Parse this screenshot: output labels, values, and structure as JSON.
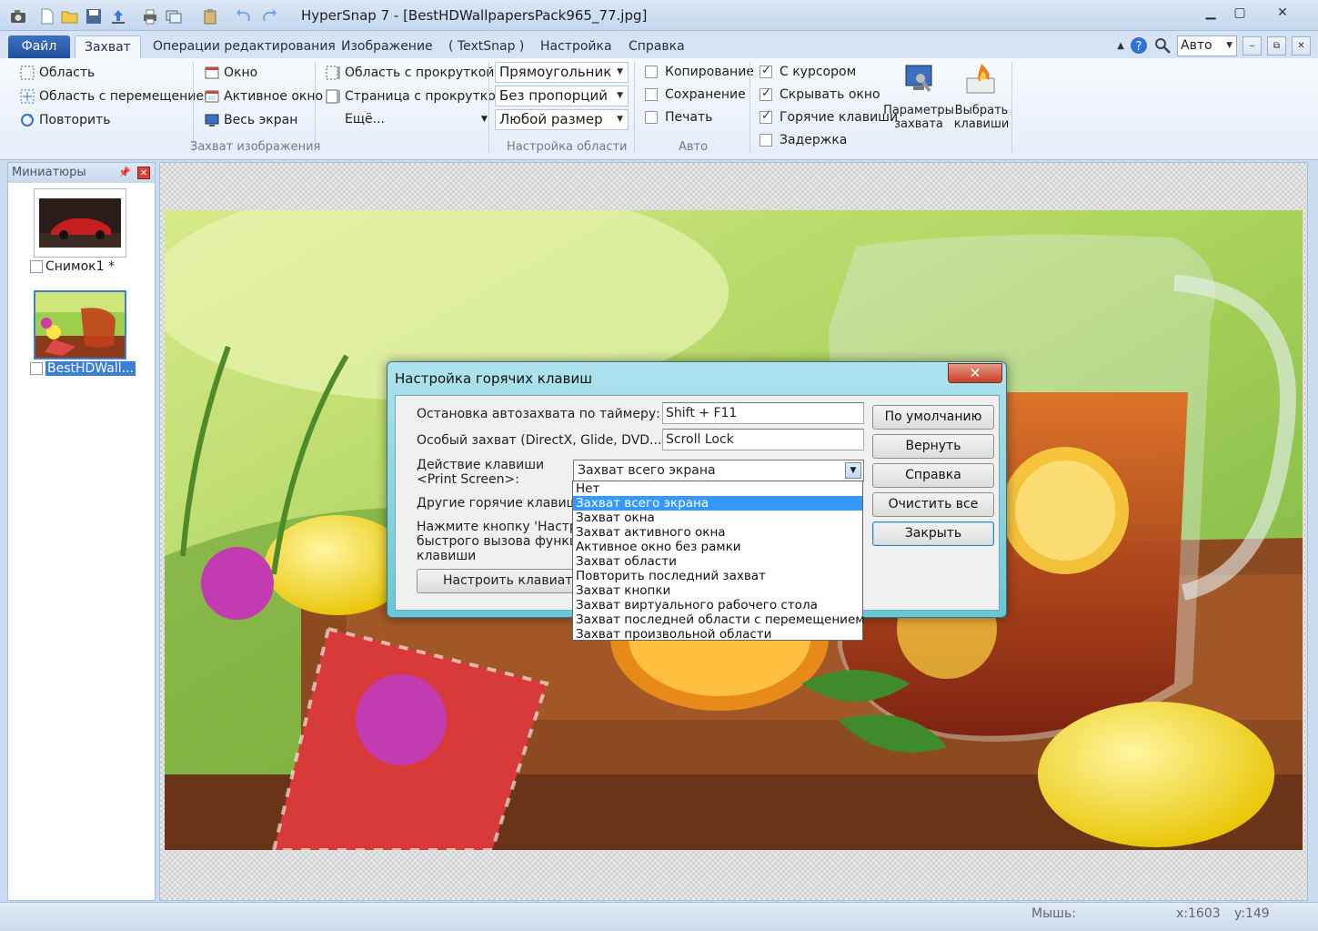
{
  "window": {
    "title": "HyperSnap 7 - [BestHDWallpapersPack965_77.jpg]",
    "controls": [
      "▁",
      "▢",
      "✕"
    ]
  },
  "tabs": {
    "file": "Файл",
    "items": [
      "Захват",
      "Операции редактирования",
      "Изображение",
      "( TextSnap )",
      "Настройка",
      "Справка"
    ],
    "active": "Захват",
    "zoom_value": "Авто",
    "mini": [
      "‒",
      "⧉",
      "✕"
    ]
  },
  "ribbon": {
    "capture_group": {
      "col1": [
        "Область",
        "Область с перемещением",
        "Повторить"
      ],
      "col2": [
        "Окно",
        "Активное окно",
        "Весь экран"
      ],
      "col3": [
        "Область с прокруткой",
        "Страница с прокруткой",
        "Ещё..."
      ],
      "label": "Захват изображения"
    },
    "region_group": {
      "combos": [
        "Прямоугольник",
        "Без пропорций",
        "Любой размер"
      ],
      "label": "Настройка области"
    },
    "auto_group": {
      "items": [
        "Копирование",
        "Сохранение",
        "Печать"
      ],
      "label": "Авто"
    },
    "options": [
      {
        "label": "С курсором",
        "checked": true
      },
      {
        "label": "Скрывать окно",
        "checked": true
      },
      {
        "label": "Горячие клавиши",
        "checked": true
      },
      {
        "label": "Задержка",
        "checked": false
      }
    ],
    "big_buttons": {
      "capture_params": "Параметры захвата",
      "choose_keys": "Выбрать клавиши"
    }
  },
  "thumbnails": {
    "title": "Миниатюры",
    "items": [
      {
        "label": "Снимок1 *",
        "selected": false
      },
      {
        "label": "BestHDWall...",
        "selected": true
      }
    ]
  },
  "dialog": {
    "title": "Настройка горячих клавиш",
    "close": "✕",
    "fields": {
      "timer_stop_label": "Остановка автозахвата по таймеру:",
      "timer_stop_value": "Shift + F11",
      "special_label": "Особый захват (DirectX, Glide, DVD...):",
      "special_value": "Scroll Lock",
      "printscreen_label_1": "Действие клавиши",
      "printscreen_label_2": "<Print Screen>:",
      "printscreen_value": "Захват всего экрана",
      "other_label": "Другие горячие клавиши",
      "hint_1": "Нажмите кнопку 'Настроить",
      "hint_2": "быстрого вызова функций",
      "hint_3": "клавиши",
      "setup_button": "Настроить клавиатуру"
    },
    "buttons": [
      "По умолчанию",
      "Вернуть",
      "Справка",
      "Очистить все",
      "Закрыть"
    ]
  },
  "dropdown": {
    "options": [
      "Нет",
      "Захват всего экрана",
      "Захват окна",
      "Захват активного окна",
      "Активное окно без рамки",
      "Захват области",
      "Повторить последний захват",
      "Захват кнопки",
      "Захват виртуального рабочего стола",
      "Захват последней области с перемещением",
      "Захват произвольной области"
    ],
    "selected_index": 1
  },
  "status": {
    "mouse_label": "Мышь:",
    "x": "x:1603",
    "y": "y:149"
  },
  "colors": {
    "accent": "#3399ff",
    "ribbon_bg": "#e4edf8",
    "dialog_frame": "#66c8d6"
  }
}
